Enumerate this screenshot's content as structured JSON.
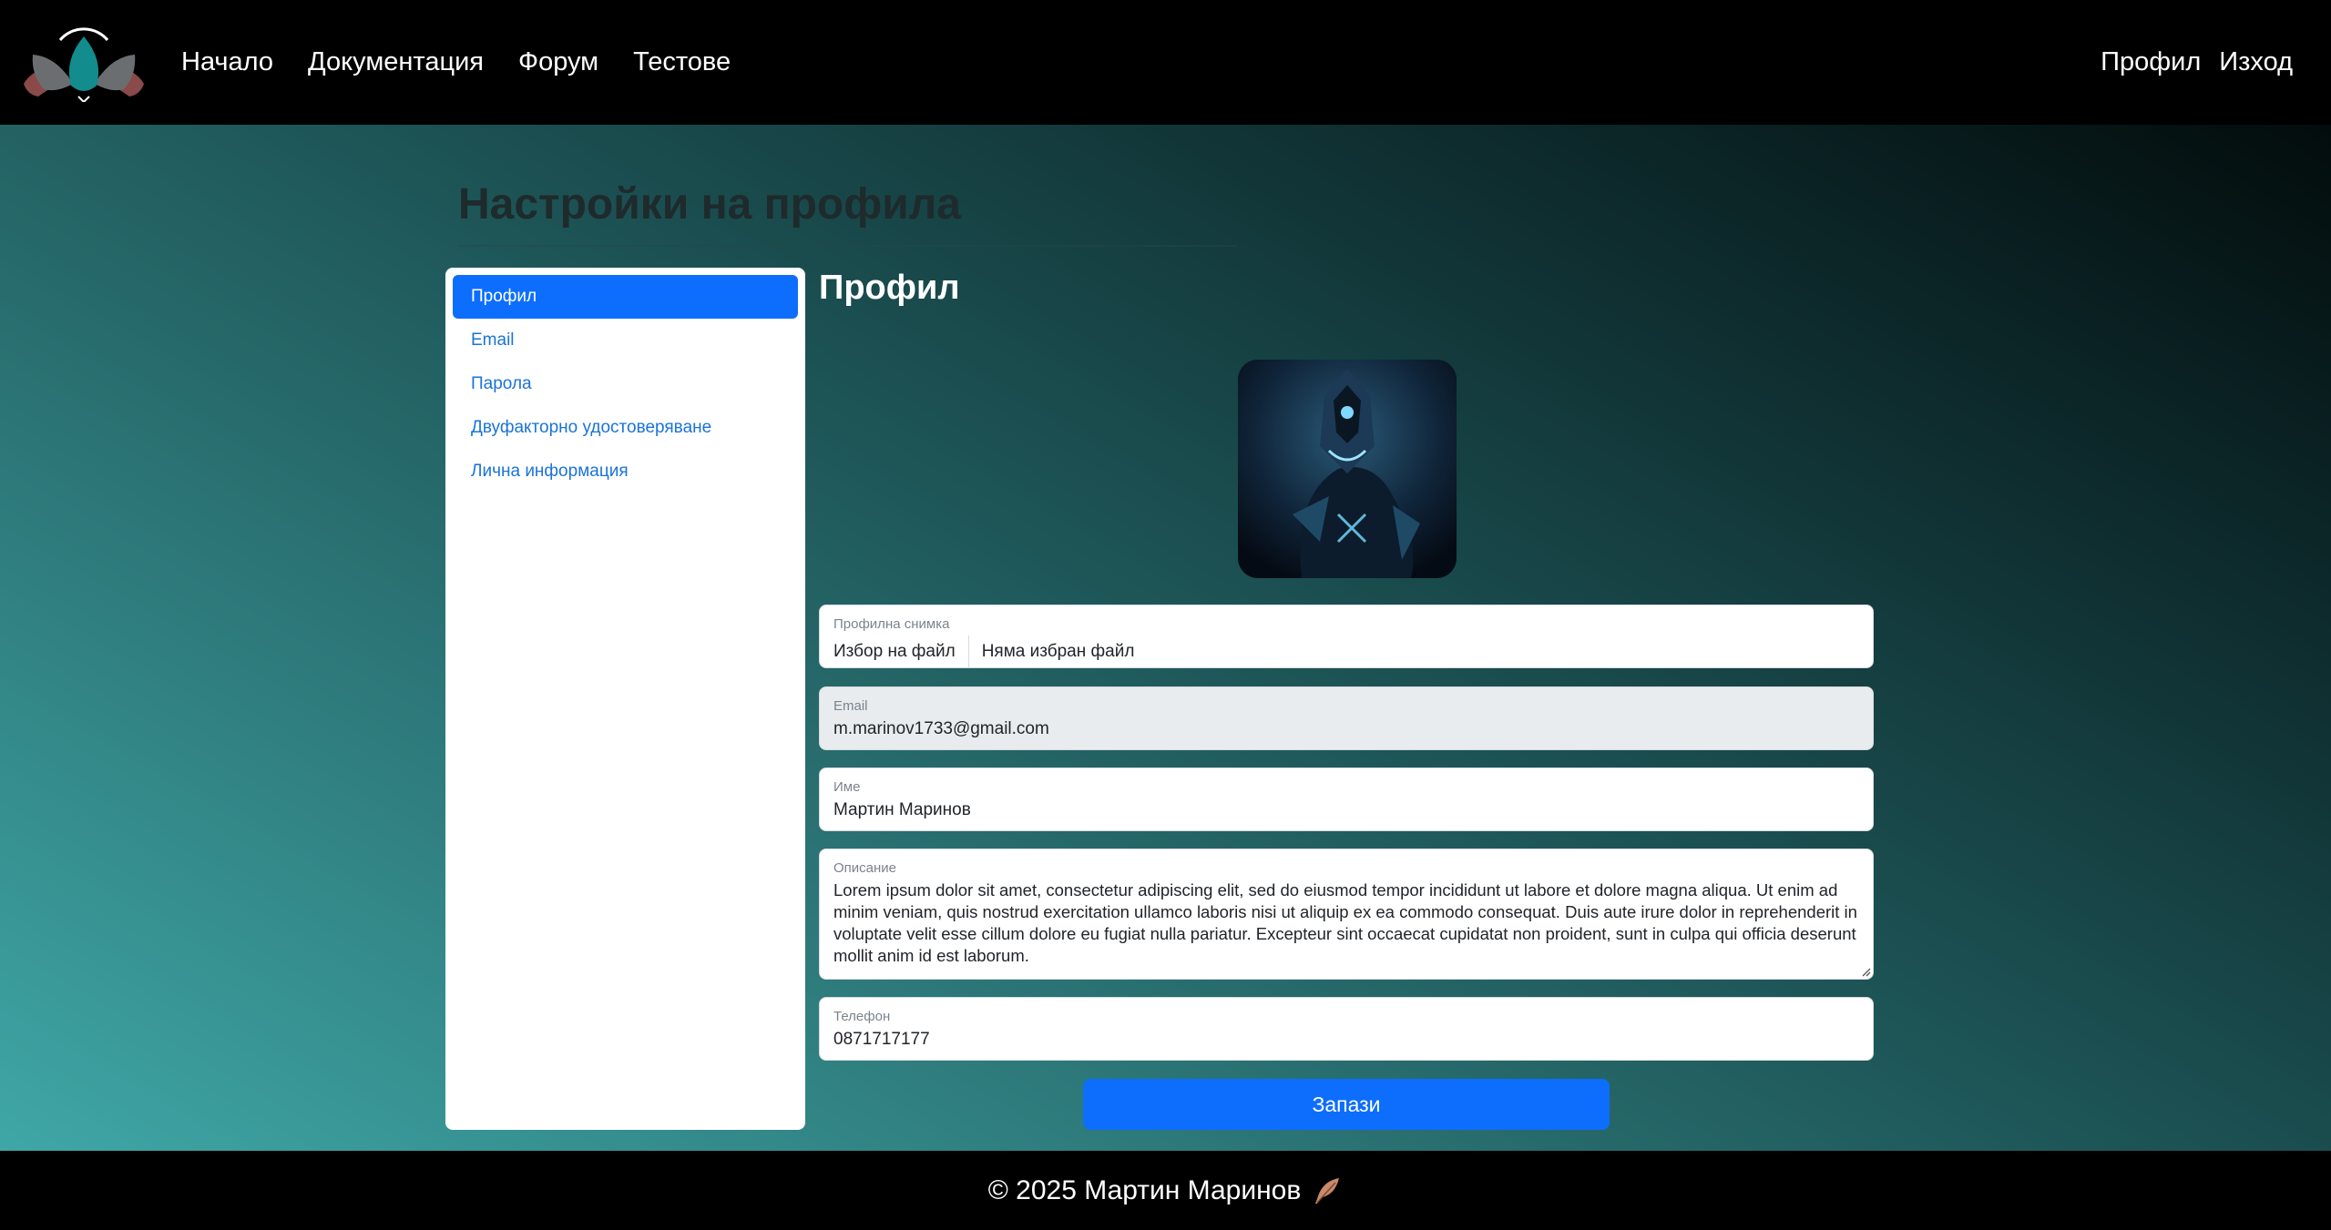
{
  "nav": {
    "links": [
      "Начало",
      "Документация",
      "Форум",
      "Тестове"
    ],
    "right": [
      "Профил",
      "Изход"
    ]
  },
  "page": {
    "title": "Настройки на профила"
  },
  "sidebar": {
    "items": [
      {
        "label": "Профил",
        "active": true
      },
      {
        "label": "Email",
        "active": false
      },
      {
        "label": "Парола",
        "active": false
      },
      {
        "label": "Двуфакторно удостоверяване",
        "active": false
      },
      {
        "label": "Лична информация",
        "active": false
      }
    ]
  },
  "profile": {
    "section_title": "Профил",
    "photo": {
      "label": "Профилна снимка",
      "button": "Избор на файл",
      "status": "Няма избран файл"
    },
    "email": {
      "label": "Email",
      "value": "m.marinov1733@gmail.com"
    },
    "name": {
      "label": "Име",
      "value": "Мартин Маринов"
    },
    "description": {
      "label": "Описание",
      "value": "Lorem ipsum dolor sit amet, consectetur adipiscing elit, sed do eiusmod tempor incididunt ut labore et dolore magna aliqua. Ut enim ad minim veniam, quis nostrud exercitation ullamco laboris nisi ut aliquip ex ea commodo consequat. Duis aute irure dolor in reprehenderit in voluptate velit esse cillum dolore eu fugiat nulla pariatur. Excepteur sint occaecat cupidatat non proident, sunt in culpa qui officia deserunt mollit anim id est laborum."
    },
    "phone": {
      "label": "Телефон",
      "value": "0871717177"
    },
    "save_label": "Запази"
  },
  "footer": {
    "text": "© 2025 Мартин Маринов"
  },
  "colors": {
    "primary": "#0d6efd",
    "navbar": "#000000",
    "link": "#1a73d9"
  },
  "icons": {
    "logo": "lotus-logo-icon",
    "footer": "feather-icon"
  }
}
